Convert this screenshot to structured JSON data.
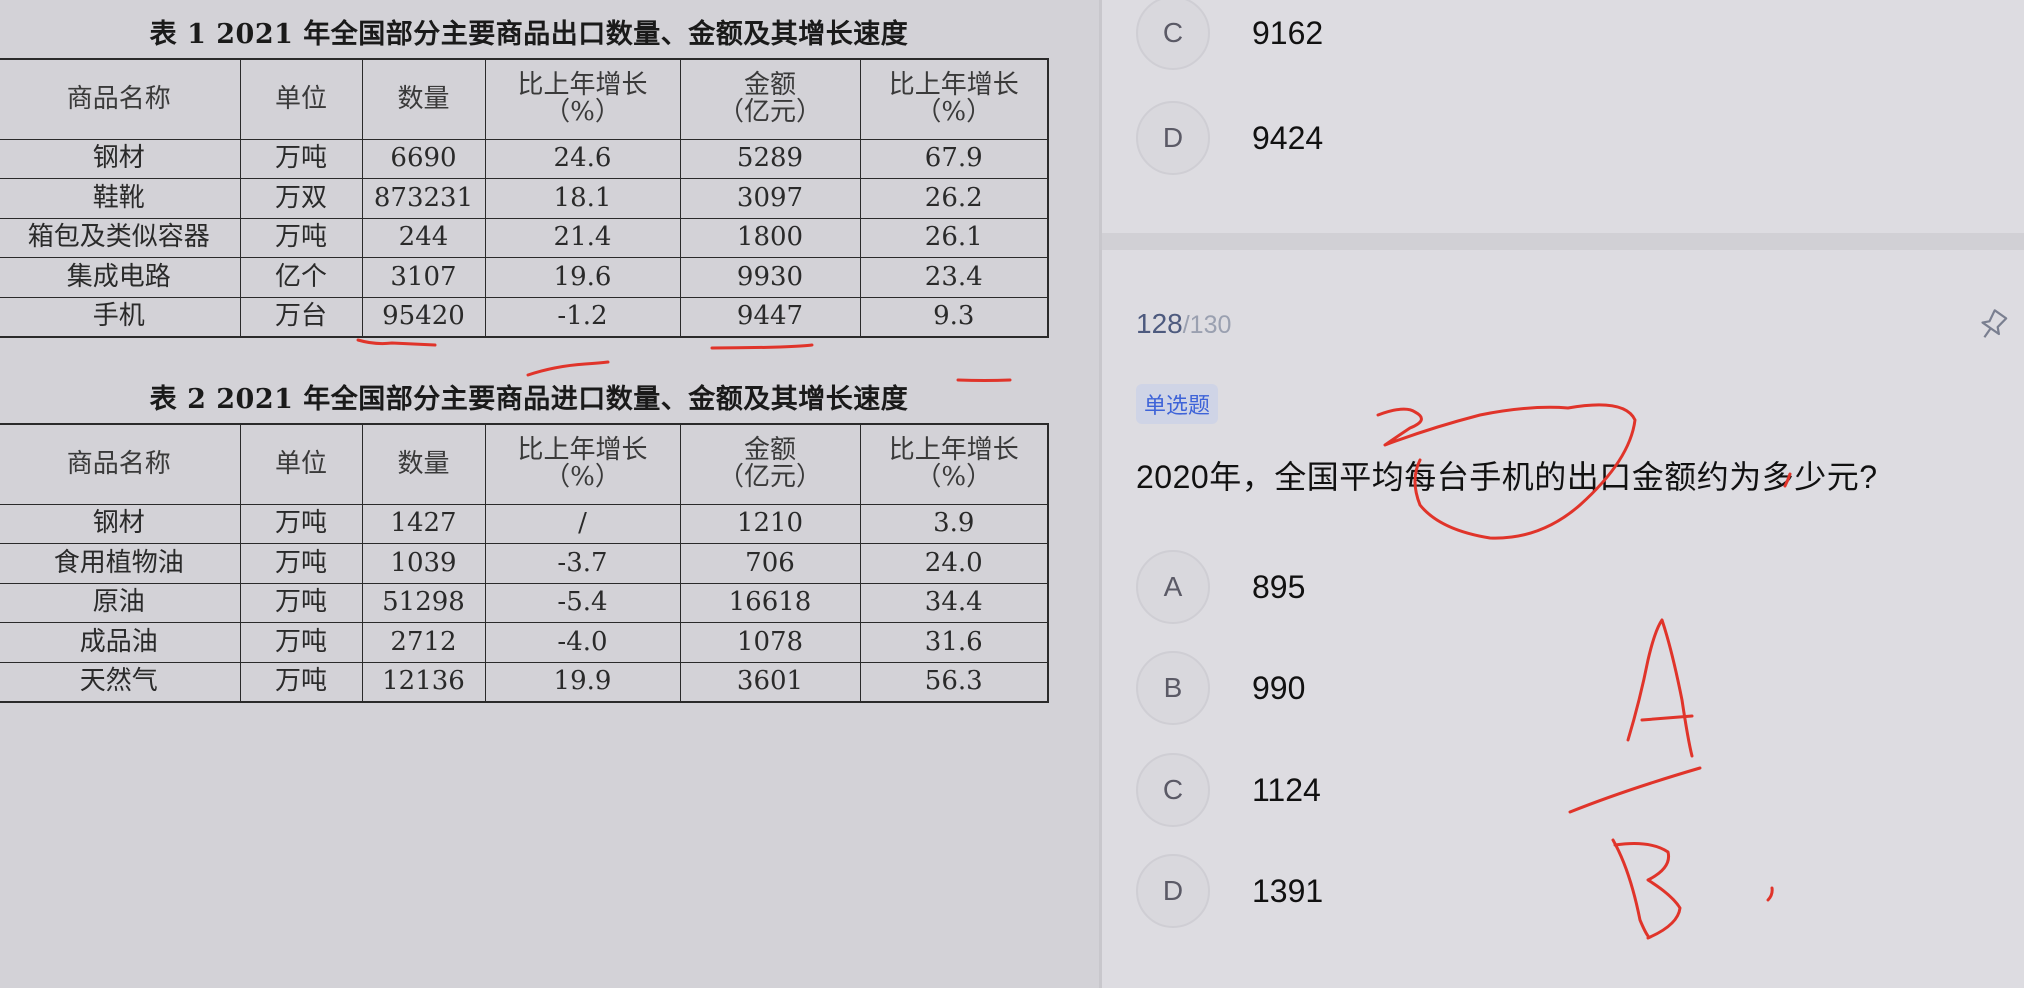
{
  "table1": {
    "title": "表 1  2021 年全国部分主要商品出口数量、金额及其增长速度",
    "headers": [
      {
        "line1": "商品名称",
        "line2": ""
      },
      {
        "line1": "单位",
        "line2": ""
      },
      {
        "line1": "数量",
        "line2": ""
      },
      {
        "line1": "比上年增长",
        "line2": "（%）"
      },
      {
        "line1": "金额",
        "line2": "（亿元）"
      },
      {
        "line1": "比上年增长",
        "line2": "（%）"
      }
    ],
    "rows": [
      [
        "钢材",
        "万吨",
        "6690",
        "24.6",
        "5289",
        "67.9"
      ],
      [
        "鞋靴",
        "万双",
        "873231",
        "18.1",
        "3097",
        "26.2"
      ],
      [
        "箱包及类似容器",
        "万吨",
        "244",
        "21.4",
        "1800",
        "26.1"
      ],
      [
        "集成电路",
        "亿个",
        "3107",
        "19.6",
        "9930",
        "23.4"
      ],
      [
        "手机",
        "万台",
        "95420",
        "-1.2",
        "9447",
        "9.3"
      ]
    ]
  },
  "table2": {
    "title": "表 2  2021 年全国部分主要商品进口数量、金额及其增长速度",
    "headers": [
      {
        "line1": "商品名称",
        "line2": ""
      },
      {
        "line1": "单位",
        "line2": ""
      },
      {
        "line1": "数量",
        "line2": ""
      },
      {
        "line1": "比上年增长",
        "line2": "（%）"
      },
      {
        "line1": "金额",
        "line2": "（亿元）"
      },
      {
        "line1": "比上年增长",
        "line2": "（%）"
      }
    ],
    "rows": [
      [
        "钢材",
        "万吨",
        "1427",
        "/",
        "1210",
        "3.9"
      ],
      [
        "食用植物油",
        "万吨",
        "1039",
        "-3.7",
        "706",
        "24.0"
      ],
      [
        "原油",
        "万吨",
        "51298",
        "-5.4",
        "16618",
        "34.4"
      ],
      [
        "成品油",
        "万吨",
        "2712",
        "-4.0",
        "1078",
        "31.6"
      ],
      [
        "天然气",
        "万吨",
        "12136",
        "19.9",
        "3601",
        "56.3"
      ]
    ]
  },
  "prev_question": {
    "options": [
      {
        "letter": "C",
        "text": "9162"
      },
      {
        "letter": "D",
        "text": "9424"
      }
    ]
  },
  "question": {
    "current": "128",
    "total": "/130",
    "type": "单选题",
    "text": "2020年，全国平均每台手机的出口金额约为多少元?",
    "options": [
      {
        "letter": "A",
        "text": "895"
      },
      {
        "letter": "B",
        "text": "990"
      },
      {
        "letter": "C",
        "text": "1124"
      },
      {
        "letter": "D",
        "text": "1391"
      }
    ]
  },
  "colors": {
    "ink": "#e0342a",
    "accent": "#3e63d8"
  },
  "icons": {
    "pin": "pin-icon"
  }
}
